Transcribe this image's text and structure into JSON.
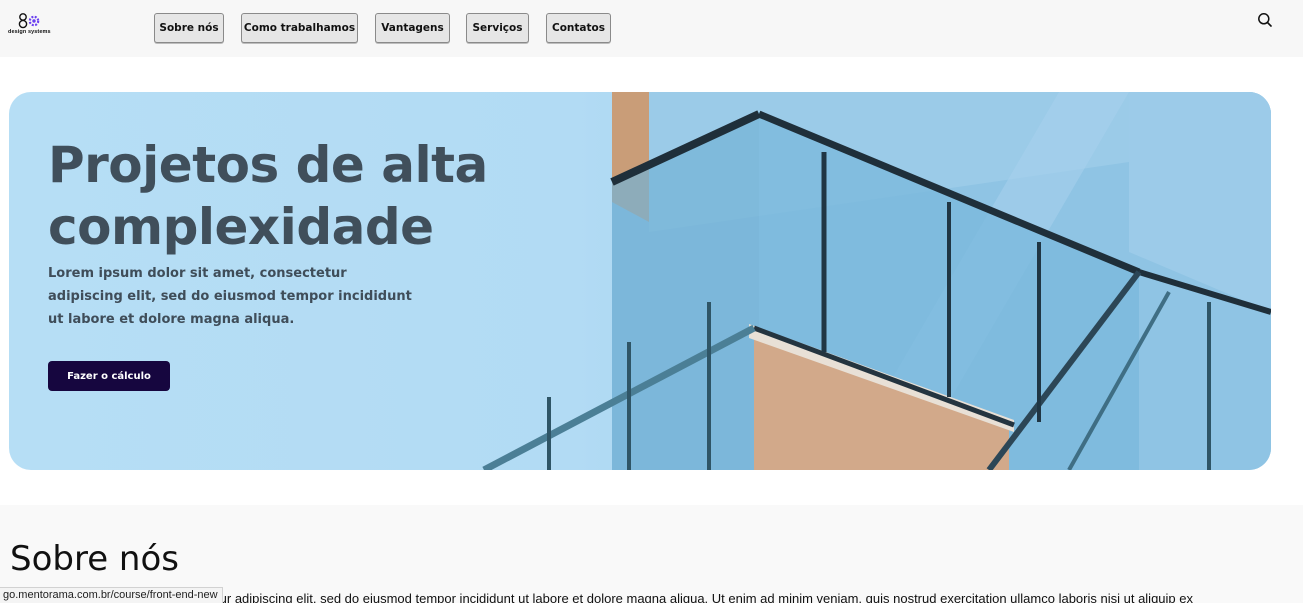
{
  "header": {
    "logo_text": "design systems",
    "nav": [
      {
        "label": "Sobre nós"
      },
      {
        "label": "Como trabalhamos"
      },
      {
        "label": "Vantagens"
      },
      {
        "label": "Serviços"
      },
      {
        "label": "Contatos"
      }
    ],
    "search_icon": "search-icon"
  },
  "hero": {
    "title": "Projetos de alta complexidade",
    "text": "Lorem ipsum dolor sit amet, consectetur adipiscing elit, sed do eiusmod tempor incididunt ut labore et dolore magna aliqua.",
    "cta_label": "Fazer o cálculo"
  },
  "about": {
    "title": "Sobre nós",
    "text": "Lorem ipsum dolor sit amet, consectetur adipiscing elit, sed do eiusmod tempor incididunt ut labore et dolore magna aliqua. Ut enim ad minim veniam, quis nostrud exercitation ullamco laboris nisi ut aliquip ex"
  },
  "status_bar": {
    "url": "go.mentorama.com.br/course/front-end-new"
  },
  "colors": {
    "cta_background": "#16063f",
    "hero_text": "#404f5b",
    "logo_accent": "#6a3ff0"
  }
}
